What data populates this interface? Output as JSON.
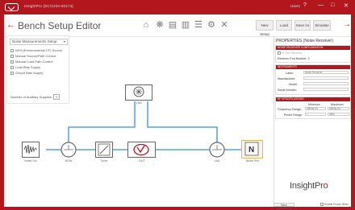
{
  "window": {
    "title": "InsightPro [SC/1234-00174]",
    "user": "User1",
    "controls": [
      "?",
      "—",
      "□",
      "✕"
    ]
  },
  "header": {
    "back_icon": "←",
    "title": "Bench Setup Editor",
    "toolbar_icons": [
      "home-icon",
      "component-icon",
      "panel-icon",
      "panel-alt-icon",
      "list-icon",
      "settings-icon",
      "tools-icon"
    ],
    "buttons": {
      "new_setup": "New Setup",
      "load": "Load",
      "save_as": "Save As",
      "simulate": "Simulate"
    },
    "forward_icon": "→"
  },
  "setup": {
    "type_value": "Noise Measurements Setup",
    "options": [
      "NFM (Environmental CF) Source",
      "Manual Source/Path Control",
      "Manual Load Path Control",
      "Load Bias Supply",
      "Output Bias Supply"
    ],
    "aux_label": "Number of Auxiliary Supplies",
    "aux_value": "0"
  },
  "diagram": {
    "blocks": {
      "vna": "VNA",
      "noise_src": "Noise Src",
      "tuner_in": "NOW",
      "tuner": "Tuner",
      "dut": "DUT",
      "tuner_out": "LNA",
      "noise_rec": "Noise Rec"
    }
  },
  "properties": {
    "title": "PROPERTIES (Noise Receiver)",
    "model_section": "NOISE RECEIVER CONFIGURATION",
    "use_receiver": "In Use Receiver",
    "receiver_port_label": "Receiver Port Number:",
    "receiver_port_value": "2",
    "instrument_section": "INSTRUMENTS",
    "label_label": "Label:",
    "label_value": "Noise Receiver",
    "manufacturer_label": "Manufacturer:",
    "model_label": "Model:",
    "serial_label": "Serial Number:",
    "rf_section": "RF SPECIFICATIONS",
    "min_header": "Minimum",
    "max_header": "Maximum",
    "freq_label": "Frequency Range:",
    "freq_min": "Infinity Hz",
    "freq_max": "Infinity Hz",
    "power_label": "Power Range:",
    "power_min": "–",
    "power_max": "dBm"
  },
  "brand": {
    "name": "InsightPr",
    "o": "o"
  },
  "footer": {
    "left_button": "Save Configuration",
    "right_check": "Enable Power Meter"
  },
  "colors": {
    "accent": "#b4161e",
    "wire": "#3a8fd1"
  }
}
